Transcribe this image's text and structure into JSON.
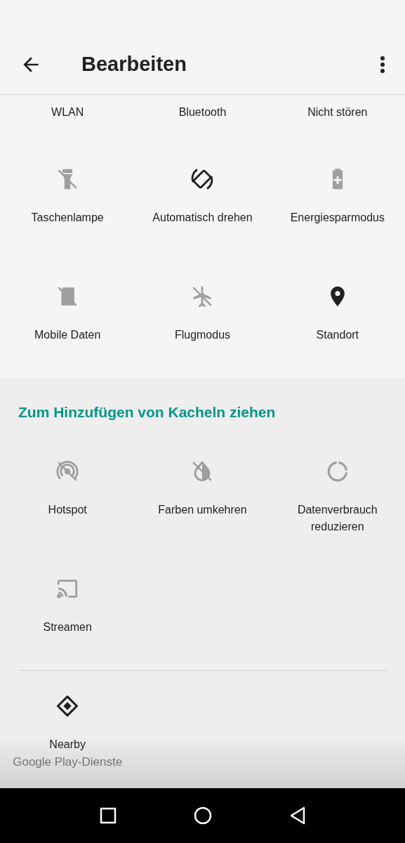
{
  "toolbar": {
    "title": "Bearbeiten"
  },
  "active_tiles": [
    {
      "label": "WLAN"
    },
    {
      "label": "Bluetooth"
    },
    {
      "label": "Nicht stören"
    },
    {
      "label": "Taschenlampe",
      "kind": "flashlight",
      "on": false
    },
    {
      "label": "Automatisch drehen",
      "kind": "rotate",
      "on": true
    },
    {
      "label": "Energiesparmodus",
      "kind": "battery",
      "on": false
    },
    {
      "label": "Mobile Daten",
      "kind": "simcard",
      "on": false
    },
    {
      "label": "Flugmodus",
      "kind": "airplane",
      "on": false
    },
    {
      "label": "Standort",
      "kind": "location",
      "on": true
    }
  ],
  "available_section": {
    "heading": "Zum Hinzufügen von Kacheln ziehen",
    "tiles": [
      {
        "label": "Hotspot",
        "kind": "hotspot",
        "on": false
      },
      {
        "label": "Farben umkehren",
        "kind": "invert",
        "on": false
      },
      {
        "label": "Datenverbrauch reduzieren",
        "kind": "datasaver",
        "on": false
      },
      {
        "label": "Streamen",
        "kind": "cast",
        "on": false
      }
    ],
    "app_tiles": [
      {
        "label": "Nearby",
        "app": "Google Play-Dienste",
        "kind": "nearby",
        "on": true
      }
    ]
  }
}
